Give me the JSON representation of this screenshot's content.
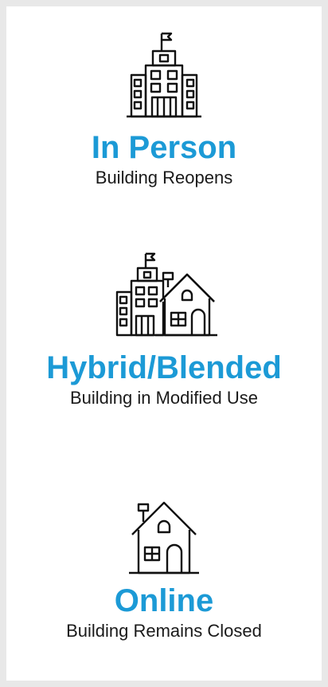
{
  "options": [
    {
      "title": "In Person",
      "subtitle": "Building Reopens",
      "icon": "school-building-icon"
    },
    {
      "title": "Hybrid/Blended",
      "subtitle": "Building in Modified Use",
      "icon": "school-and-house-icon"
    },
    {
      "title": "Online",
      "subtitle": "Building Remains Closed",
      "icon": "house-icon"
    }
  ],
  "colors": {
    "title": "#1c9ad6",
    "subtitle": "#1a1a1a",
    "background": "#ffffff",
    "frame": "#e8e8e8",
    "icon_stroke": "#111111"
  }
}
